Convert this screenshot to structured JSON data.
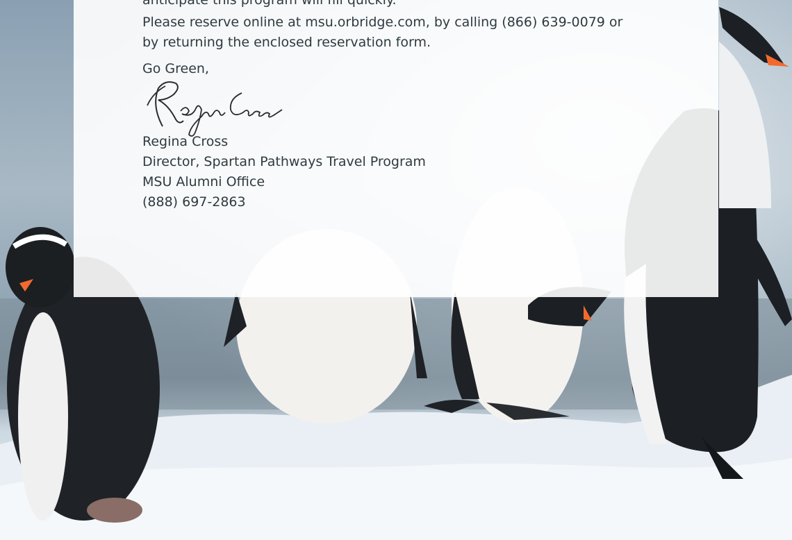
{
  "letter": {
    "intro_tail": "anticipate this program will fill quickly.",
    "reserve_text": "Please reserve online at msu.orbridge.com, by calling (866) 639-0079 or by returning the enclosed reservation form.",
    "closing": "Go Green,",
    "signer": {
      "name": "Regina Cross",
      "title": "Director, Spartan Pathways Travel Program",
      "office": "MSU Alumni Office",
      "phone": "(888) 697-2863"
    }
  },
  "colors": {
    "card_background": "#ffffff",
    "text": "#2f3a40",
    "beak_orange": "#f26a2e"
  }
}
